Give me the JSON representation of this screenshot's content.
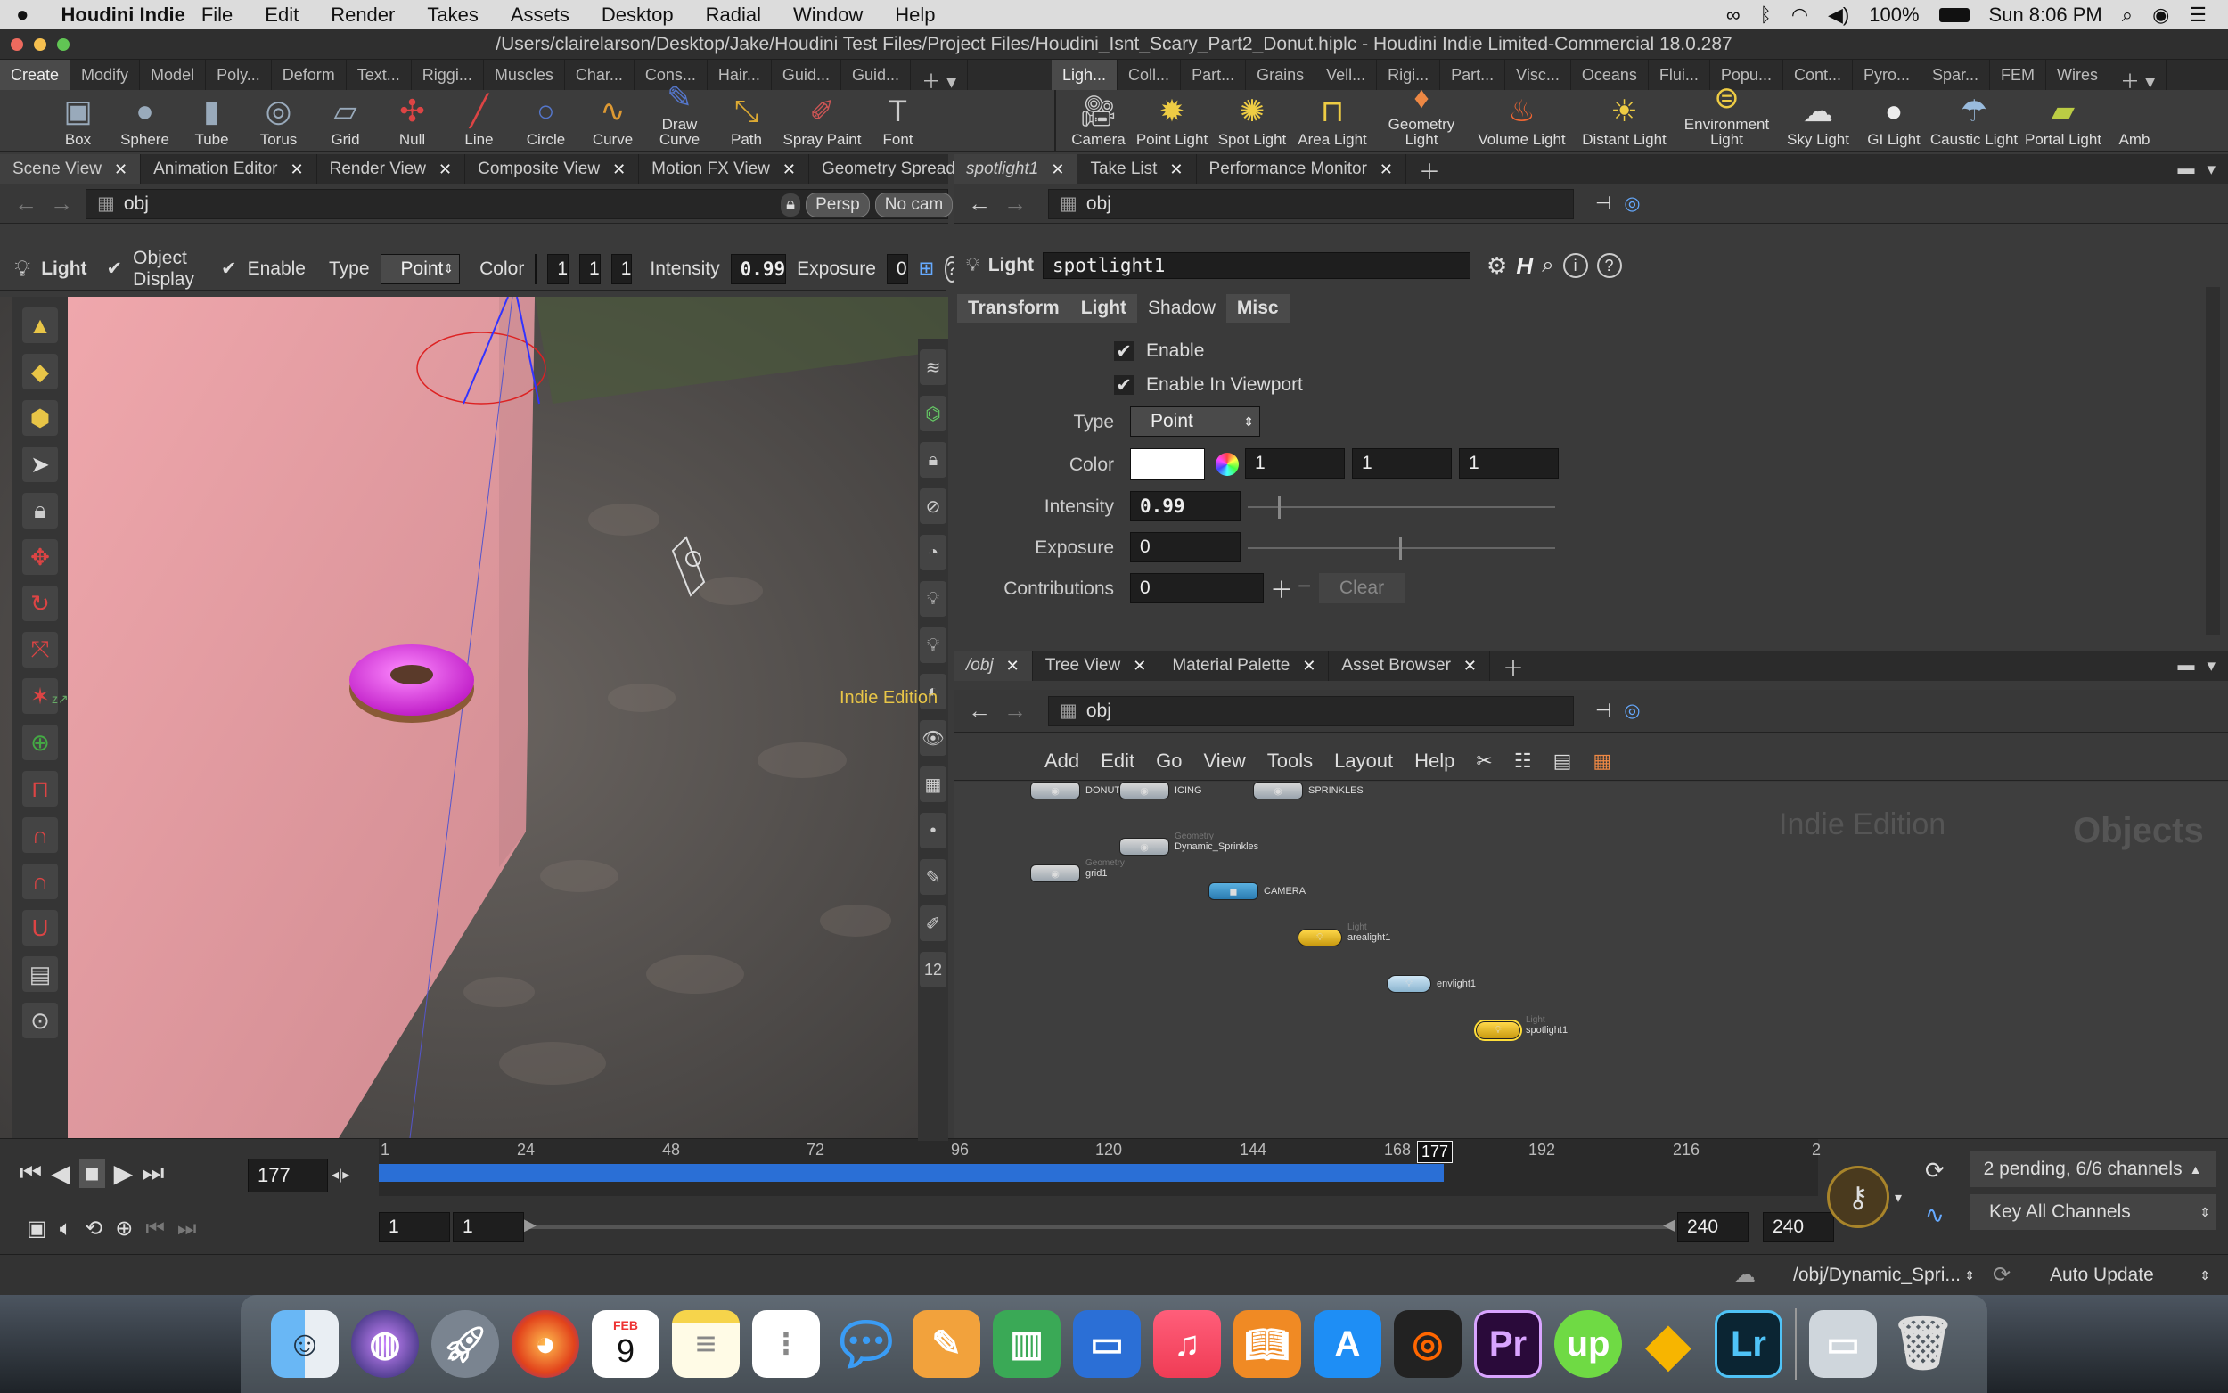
{
  "menubar": {
    "app_name": "Houdini Indie",
    "items": [
      "File",
      "Edit",
      "Render",
      "Takes",
      "Assets",
      "Desktop",
      "Radial",
      "Window",
      "Help"
    ],
    "battery": "100%",
    "clock": "Sun 8:06 PM"
  },
  "window_title": "/Users/clairelarson/Desktop/Jake/Houdini Test Files/Project Files/Houdini_Isnt_Scary_Part2_Donut.hiplc - Houdini Indie Limited-Commercial 18.0.287",
  "shelf": {
    "left_tabs": [
      "Create",
      "Modify",
      "Model",
      "Poly...",
      "Deform",
      "Text...",
      "Riggi...",
      "Muscles",
      "Char...",
      "Cons...",
      "Hair...",
      "Guid...",
      "Guid..."
    ],
    "right_tabs": [
      "Ligh...",
      "Coll...",
      "Part...",
      "Grains",
      "Vell...",
      "Rigi...",
      "Part...",
      "Visc...",
      "Oceans",
      "Flui...",
      "Popu...",
      "Cont...",
      "Pyro...",
      "Spar...",
      "FEM",
      "Wires"
    ],
    "left_tools": [
      "Box",
      "Sphere",
      "Tube",
      "Torus",
      "Grid",
      "Null",
      "Line",
      "Circle",
      "Curve",
      "Draw Curve",
      "Path",
      "Spray Paint",
      "Font"
    ],
    "right_tools": [
      "Camera",
      "Point Light",
      "Spot Light",
      "Area Light",
      "Geometry Light",
      "Volume Light",
      "Distant Light",
      "Environment Light",
      "Sky Light",
      "GI Light",
      "Caustic Light",
      "Portal Light",
      "Amb"
    ]
  },
  "left_pane": {
    "tabs": [
      "Scene View",
      "Animation Editor",
      "Render View",
      "Composite View",
      "Motion FX View",
      "Geometry Spreadsheet"
    ],
    "path": "obj",
    "toolbar": {
      "mode": "Light",
      "object_display": "Object Display",
      "enable": "Enable",
      "type_label": "Type",
      "type_value": "Point",
      "color_label": "Color",
      "color_r": "1",
      "color_g": "1",
      "color_b": "1",
      "intensity_label": "Intensity",
      "intensity_value": "0.99",
      "exposure_label": "Exposure",
      "exposure_value": "0"
    },
    "viewport": {
      "persp": "Persp",
      "cam": "No cam",
      "watermark": "Indie Edition"
    }
  },
  "param_pane": {
    "tabs": [
      "spotlight1",
      "Take List",
      "Performance Monitor"
    ],
    "path": "obj",
    "node_type": "Light",
    "node_name": "spotlight1",
    "subtabs": [
      "Transform",
      "Light",
      "Shadow",
      "Misc"
    ],
    "enable": "Enable",
    "enable_viewport": "Enable In Viewport",
    "type_label": "Type",
    "type_value": "Point",
    "color_label": "Color",
    "color_r": "1",
    "color_g": "1",
    "color_b": "1",
    "intensity_label": "Intensity",
    "intensity_value": "0.99",
    "exposure_label": "Exposure",
    "exposure_value": "0",
    "contrib_label": "Contributions",
    "contrib_value": "0",
    "clear": "Clear"
  },
  "network_pane": {
    "tabs": [
      "/obj",
      "Tree View",
      "Material Palette",
      "Asset Browser"
    ],
    "path": "obj",
    "menu": [
      "Add",
      "Edit",
      "Go",
      "View",
      "Tools",
      "Layout",
      "Help"
    ],
    "watermark": "Indie Edition",
    "context_label": "Objects",
    "nodes": [
      {
        "name": "DONUT",
        "type": ""
      },
      {
        "name": "ICING",
        "type": ""
      },
      {
        "name": "SPRINKLES",
        "type": ""
      },
      {
        "name": "Dynamic_Sprinkles",
        "type": "Geometry"
      },
      {
        "name": "grid1",
        "type": "Geometry"
      },
      {
        "name": "CAMERA",
        "type": ""
      },
      {
        "name": "arealight1",
        "type": "Light"
      },
      {
        "name": "envlight1",
        "type": ""
      },
      {
        "name": "spotlight1",
        "type": "Light"
      }
    ]
  },
  "timeline": {
    "current_frame": "177",
    "ticks": [
      "1",
      "24",
      "48",
      "72",
      "96",
      "120",
      "144",
      "168",
      "192",
      "216",
      "2"
    ],
    "range_start": "1",
    "range_start2": "1",
    "range_end": "240",
    "range_end2": "240",
    "pending": "2 pending, 6/6 channels",
    "key_all": "Key All Channels",
    "progress_fraction": 0.74
  },
  "statusbar": {
    "path": "/obj/Dynamic_Spri...",
    "update": "Auto Update"
  },
  "dock": {
    "calendar_month": "FEB",
    "calendar_day": "9",
    "apps": [
      "Finder",
      "Siri",
      "Launchpad",
      "Firefox",
      "Calendar",
      "Notes",
      "Reminders",
      "Messages",
      "Pages",
      "Numbers",
      "Keynote",
      "Music",
      "Books",
      "App Store",
      "Houdini",
      "Premiere",
      "Upwork",
      "Sketch",
      "Lightroom",
      "Folder",
      "Trash"
    ]
  }
}
